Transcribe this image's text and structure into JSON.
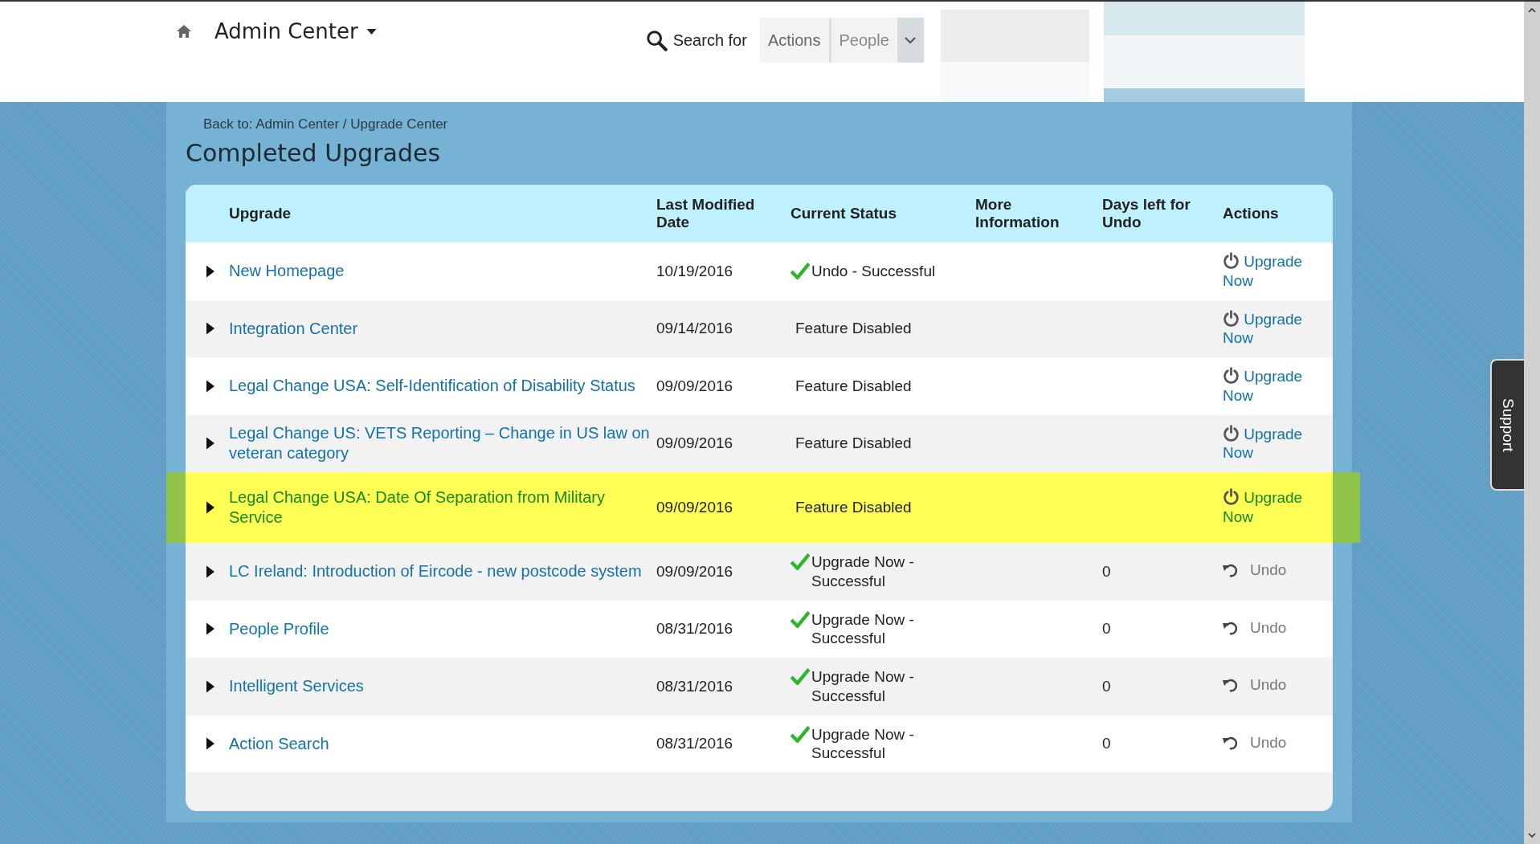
{
  "header": {
    "title": "Admin Center",
    "search_label": "Search for",
    "search_scopes": [
      {
        "label": "Actions",
        "selected": false
      },
      {
        "label": "People",
        "selected": true
      }
    ]
  },
  "breadcrumb": "Back to: Admin Center / Upgrade Center",
  "page_title": "Completed Upgrades",
  "table": {
    "columns": [
      "Upgrade",
      "Last Modified Date",
      "Current Status",
      "More Information",
      "Days left for Undo",
      "Actions"
    ],
    "rows": [
      {
        "upgrade": "New Homepage",
        "date": "10/19/2016",
        "status": "Undo - Successful",
        "status_ok": true,
        "days_left": "",
        "action": {
          "kind": "upgrade",
          "label": "Upgrade Now"
        },
        "highlighted": false
      },
      {
        "upgrade": "Integration Center",
        "date": "09/14/2016",
        "status": "Feature Disabled",
        "status_ok": false,
        "days_left": "",
        "action": {
          "kind": "upgrade",
          "label": "Upgrade Now"
        },
        "highlighted": false
      },
      {
        "upgrade": "Legal Change USA: Self-Identification of Disability Status",
        "date": "09/09/2016",
        "status": "Feature Disabled",
        "status_ok": false,
        "days_left": "",
        "action": {
          "kind": "upgrade",
          "label": "Upgrade Now"
        },
        "highlighted": false
      },
      {
        "upgrade": "Legal Change US: VETS Reporting – Change in US law on veteran category",
        "date": "09/09/2016",
        "status": "Feature Disabled",
        "status_ok": false,
        "days_left": "",
        "action": {
          "kind": "upgrade",
          "label": "Upgrade Now"
        },
        "highlighted": false
      },
      {
        "upgrade": "Legal Change USA: Date Of Separation from Military Service",
        "date": "09/09/2016",
        "status": "Feature Disabled",
        "status_ok": false,
        "days_left": "",
        "action": {
          "kind": "upgrade",
          "label": "Upgrade Now"
        },
        "highlighted": true
      },
      {
        "upgrade": "LC Ireland: Introduction of Eircode - new postcode system",
        "date": "09/09/2016",
        "status": "Upgrade Now - Successful",
        "status_ok": true,
        "days_left": "0",
        "action": {
          "kind": "undo",
          "label": "Undo"
        },
        "highlighted": false
      },
      {
        "upgrade": "People Profile",
        "date": "08/31/2016",
        "status": "Upgrade Now - Successful",
        "status_ok": true,
        "days_left": "0",
        "action": {
          "kind": "undo",
          "label": "Undo"
        },
        "highlighted": false
      },
      {
        "upgrade": "Intelligent Services",
        "date": "08/31/2016",
        "status": "Upgrade Now - Successful",
        "status_ok": true,
        "days_left": "0",
        "action": {
          "kind": "undo",
          "label": "Undo"
        },
        "highlighted": false
      },
      {
        "upgrade": "Action Search",
        "date": "08/31/2016",
        "status": "Upgrade Now - Successful",
        "status_ok": true,
        "days_left": "0",
        "action": {
          "kind": "undo",
          "label": "Undo"
        },
        "highlighted": false
      }
    ]
  },
  "support_tab": "Support"
}
